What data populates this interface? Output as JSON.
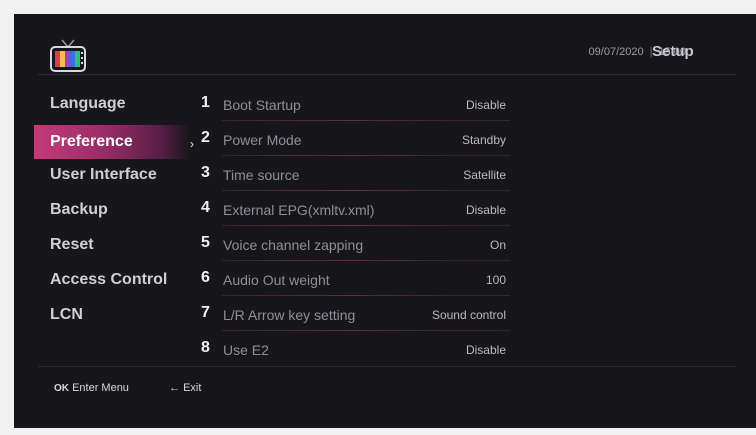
{
  "header": {
    "date": "09/07/2020",
    "separator": "|",
    "time": "15:00",
    "title": "Setup"
  },
  "icons": {
    "tv": "tv-icon",
    "chevron": "chevron-right-icon",
    "ok": "ok-key-icon",
    "back": "arrow-left-icon"
  },
  "categories": [
    {
      "label": "Language"
    },
    {
      "label": "Preference",
      "selected": true
    },
    {
      "label": "User Interface"
    },
    {
      "label": "Backup"
    },
    {
      "label": "Reset"
    },
    {
      "label": "Access Control"
    },
    {
      "label": "LCN"
    }
  ],
  "settings": [
    {
      "num": "1",
      "label": "Boot Startup",
      "value": "Disable"
    },
    {
      "num": "2",
      "label": "Power Mode",
      "value": "Standby"
    },
    {
      "num": "3",
      "label": "Time source",
      "value": "Satellite"
    },
    {
      "num": "4",
      "label": "External EPG(xmltv.xml)",
      "value": "Disable"
    },
    {
      "num": "5",
      "label": "Voice channel zapping",
      "value": "On"
    },
    {
      "num": "6",
      "label": "Audio Out weight",
      "value": "100"
    },
    {
      "num": "7",
      "label": "L/R Arrow key setting",
      "value": "Sound control"
    },
    {
      "num": "8",
      "label": "Use E2",
      "value": "Disable"
    }
  ],
  "footer": {
    "ok_key": "OK",
    "ok_label": "Enter Menu",
    "back_arrow": "←",
    "back_label": "Exit"
  },
  "colors": {
    "background": "#17171b",
    "accent": "#c23b78",
    "accent_dark": "#5a1e48"
  }
}
